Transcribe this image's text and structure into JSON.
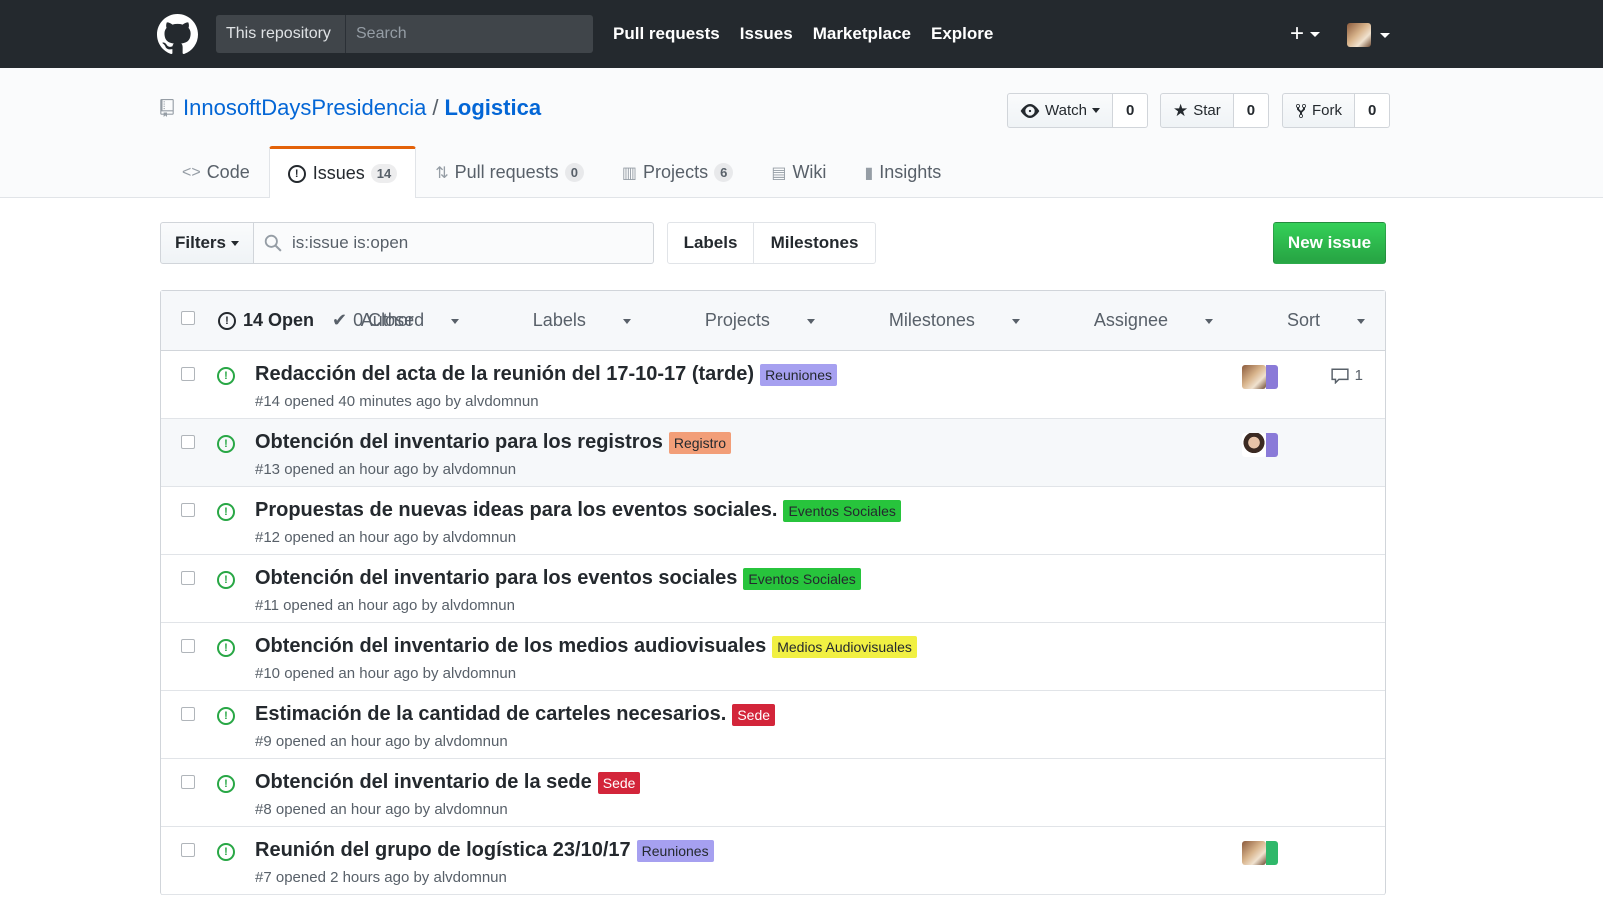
{
  "header": {
    "scope_label": "This repository",
    "search_placeholder": "Search",
    "nav": [
      "Pull requests",
      "Issues",
      "Marketplace",
      "Explore"
    ],
    "plus": "+"
  },
  "repo": {
    "owner": "InnosoftDaysPresidencia",
    "separator": "/",
    "name": "Logistica",
    "watch_label": "Watch",
    "watch_count": "0",
    "star_label": "Star",
    "star_count": "0",
    "fork_label": "Fork",
    "fork_count": "0"
  },
  "tabs": [
    {
      "label": "Code",
      "icon": "<>",
      "count": ""
    },
    {
      "label": "Issues",
      "icon": "!",
      "count": "14"
    },
    {
      "label": "Pull requests",
      "icon": "⇅",
      "count": "0"
    },
    {
      "label": "Projects",
      "icon": "▥",
      "count": "6"
    },
    {
      "label": "Wiki",
      "icon": "▤",
      "count": ""
    },
    {
      "label": "Insights",
      "icon": "▮",
      "count": ""
    }
  ],
  "filter": {
    "filters_label": "Filters",
    "query": "is:issue is:open",
    "labels_label": "Labels",
    "milestones_label": "Milestones",
    "new_issue_label": "New issue"
  },
  "list": {
    "open_label": "14 Open",
    "closed_label": "0 Closed",
    "columns": [
      "Author",
      "Labels",
      "Projects",
      "Milestones",
      "Assignee",
      "Sort"
    ]
  },
  "issues": [
    {
      "title": "Redacción del acta de la reunión del 17-10-17 (tarde)",
      "label": "Reuniones",
      "label_bg": "#a6a0f0",
      "label_fg": "#24292e",
      "meta": "#14 opened 40 minutes ago by alvdomnun",
      "comments": "1",
      "avatar": "a"
    },
    {
      "title": "Obtención del inventario para los registros",
      "label": "Registro",
      "label_bg": "#f29e78",
      "label_fg": "#24292e",
      "meta": "#13 opened an hour ago by alvdomnun",
      "comments": "",
      "avatar": "b"
    },
    {
      "title": "Propuestas de nuevas ideas para los eventos sociales.",
      "label": "Eventos Sociales",
      "label_bg": "#27c43c",
      "label_fg": "#24292e",
      "meta": "#12 opened an hour ago by alvdomnun",
      "comments": "",
      "avatar": ""
    },
    {
      "title": "Obtención del inventario para los eventos sociales",
      "label": "Eventos Sociales",
      "label_bg": "#27c43c",
      "label_fg": "#24292e",
      "meta": "#11 opened an hour ago by alvdomnun",
      "comments": "",
      "avatar": ""
    },
    {
      "title": "Obtención del inventario de los medios audiovisuales",
      "label": "Medios Audiovisuales",
      "label_bg": "#f1f043",
      "label_fg": "#24292e",
      "meta": "#10 opened an hour ago by alvdomnun",
      "comments": "",
      "avatar": ""
    },
    {
      "title": "Estimación de la cantidad de carteles necesarios.",
      "label": "Sede",
      "label_bg": "#d3253a",
      "label_fg": "#ffffff",
      "meta": "#9 opened an hour ago by alvdomnun",
      "comments": "",
      "avatar": ""
    },
    {
      "title": "Obtención del inventario de la sede",
      "label": "Sede",
      "label_bg": "#d3253a",
      "label_fg": "#ffffff",
      "meta": "#8 opened an hour ago by alvdomnun",
      "comments": "",
      "avatar": ""
    },
    {
      "title": "Reunión del grupo de logística 23/10/17",
      "label": "Reuniones",
      "label_bg": "#a6a0f0",
      "label_fg": "#24292e",
      "meta": "#7 opened 2 hours ago by alvdomnun",
      "comments": "",
      "avatar": "c"
    }
  ],
  "colors": {
    "accent": "#0366d6",
    "open_green": "#28a745",
    "header_bg": "#24292e",
    "tab_accent": "#e36209"
  }
}
